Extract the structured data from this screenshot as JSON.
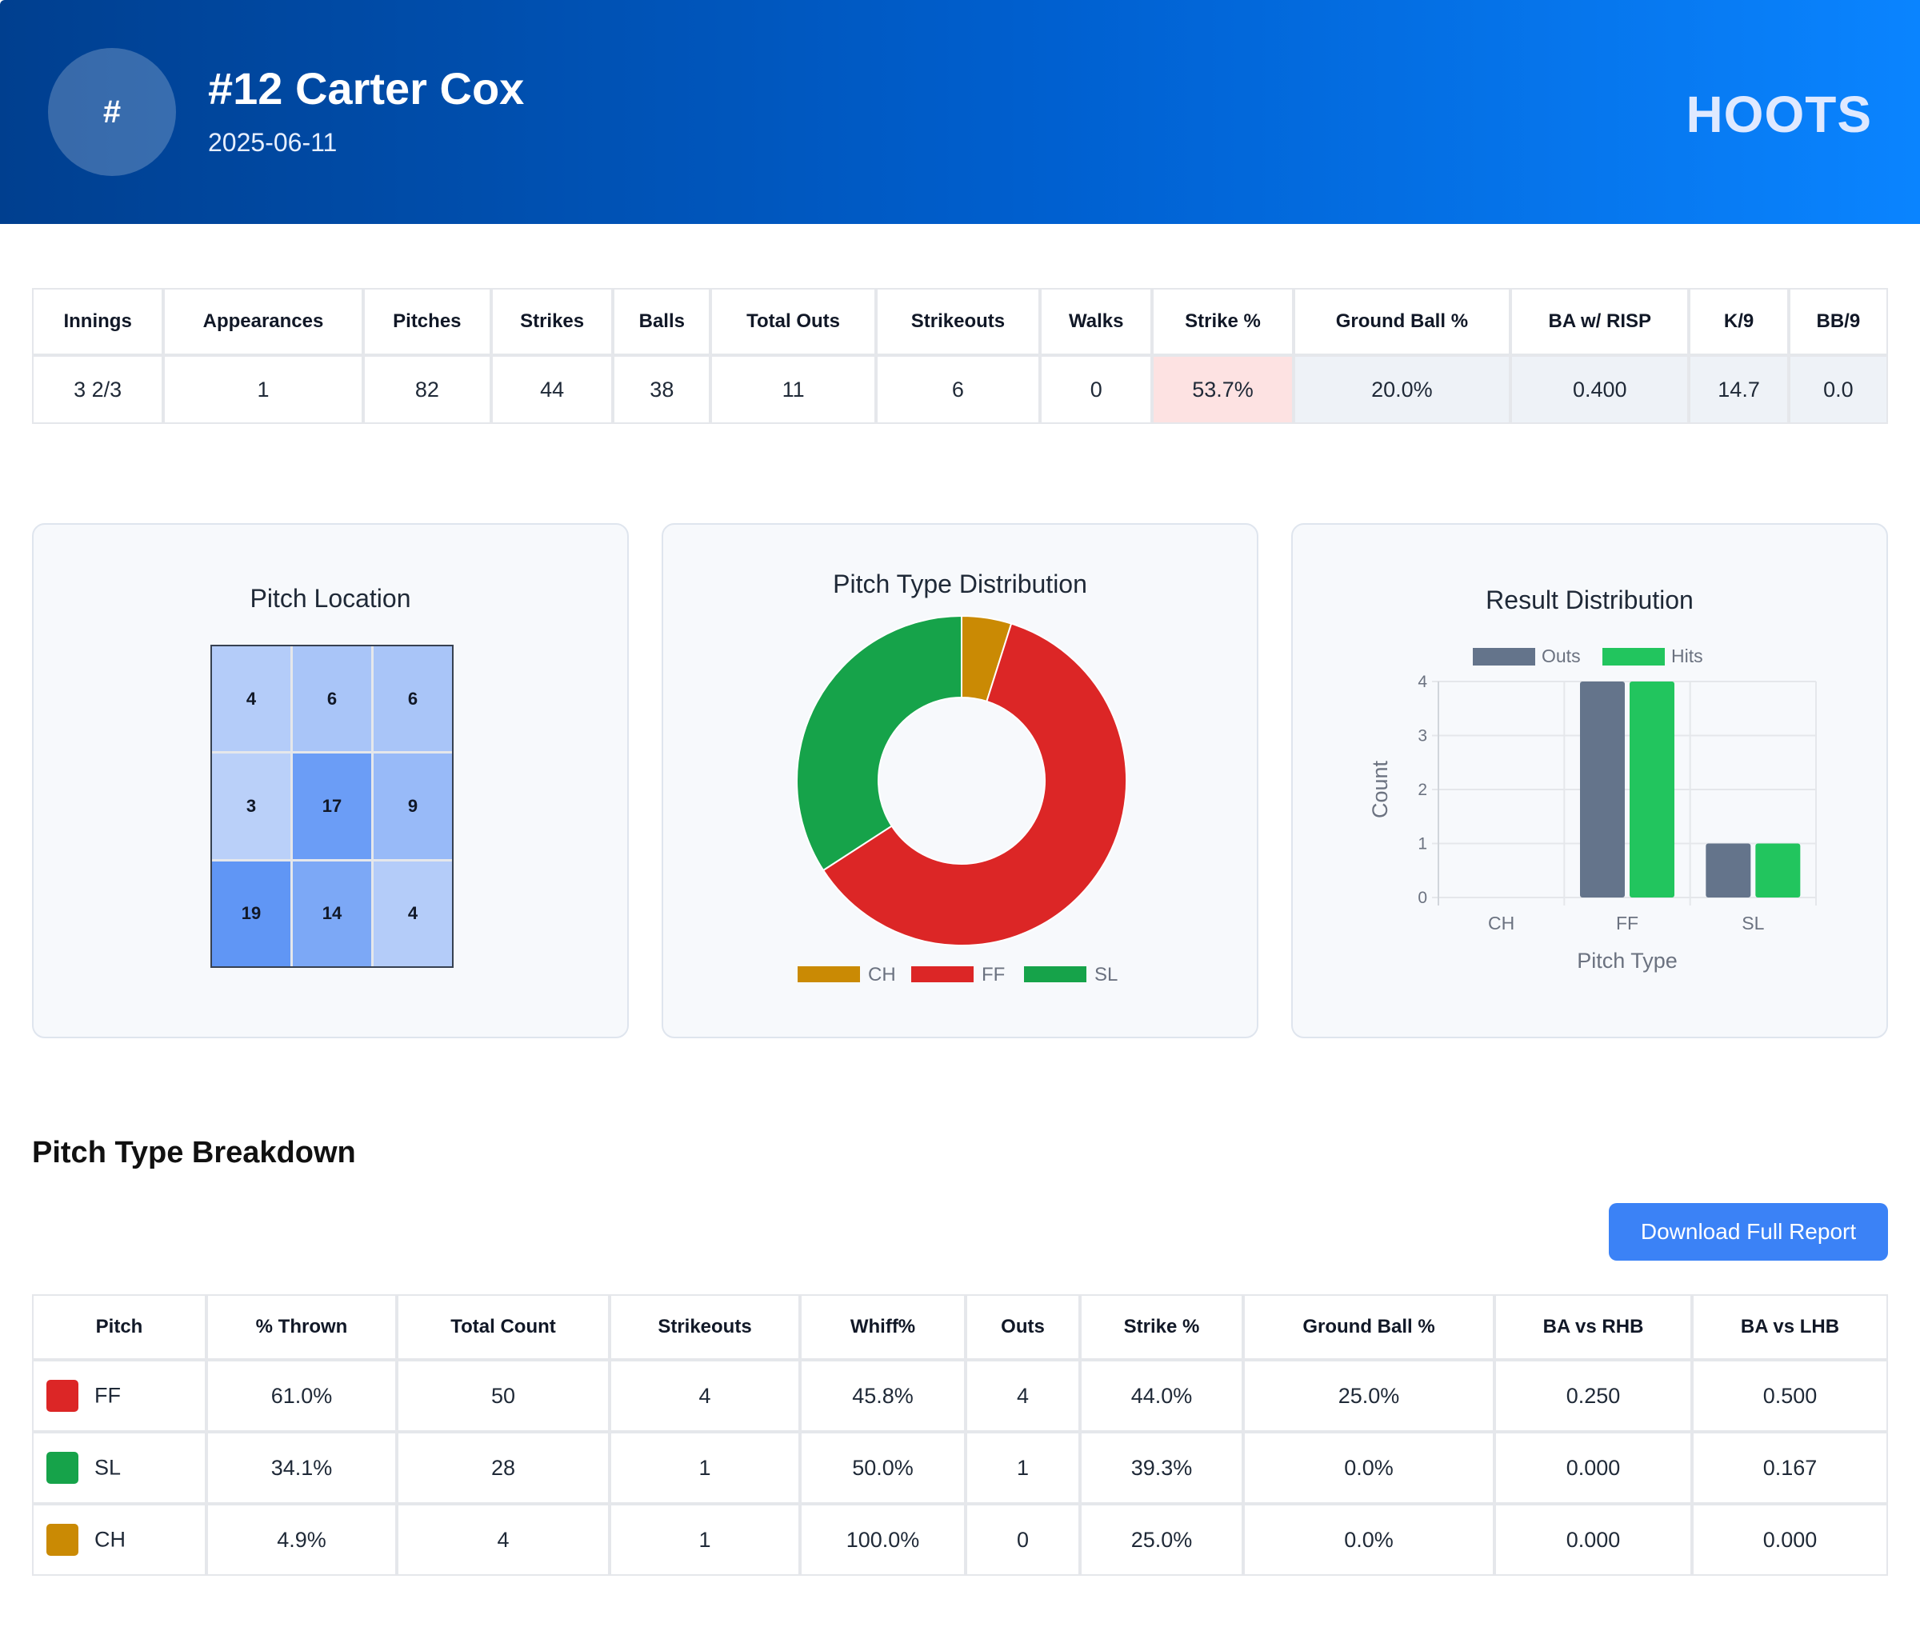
{
  "header": {
    "avatar_symbol": "#",
    "player": "#12 Carter Cox",
    "date": "2025-06-11",
    "team": "HOOTS"
  },
  "summary": {
    "columns": [
      "Innings",
      "Appearances",
      "Pitches",
      "Strikes",
      "Balls",
      "Total Outs",
      "Strikeouts",
      "Walks",
      "Strike %",
      "Ground Ball %",
      "BA w/ RISP",
      "K/9",
      "BB/9"
    ],
    "values": [
      "3 2/3",
      "1",
      "82",
      "44",
      "38",
      "11",
      "6",
      "0",
      "53.7%",
      "20.0%",
      "0.400",
      "14.7",
      "0.0"
    ]
  },
  "pitch_location": {
    "title": "Pitch Location",
    "zones": [
      "4",
      "6",
      "6",
      "3",
      "17",
      "9",
      "19",
      "14",
      "4"
    ]
  },
  "colors": {
    "FF": "#dc2626",
    "SL": "#16a34a",
    "CH": "#ca8a04",
    "outs": "#64748b",
    "hits": "#22c55e",
    "header_start": "#003f8f",
    "header_end": "#0a84ff",
    "button": "#3b82f6"
  },
  "chart_data": [
    {
      "type": "pie",
      "title": "Pitch Type Distribution",
      "categories": [
        "CH",
        "FF",
        "SL"
      ],
      "values": [
        4,
        50,
        28
      ],
      "colors": [
        "#ca8a04",
        "#dc2626",
        "#16a34a"
      ],
      "donut": true,
      "legend": "bottom"
    },
    {
      "type": "bar",
      "title": "Result Distribution",
      "categories": [
        "CH",
        "FF",
        "SL"
      ],
      "series": [
        {
          "name": "Outs",
          "values": [
            0,
            4,
            1
          ],
          "color": "#64748b"
        },
        {
          "name": "Hits",
          "values": [
            0,
            4,
            1
          ],
          "color": "#22c55e"
        }
      ],
      "xlabel": "Pitch Type",
      "ylabel": "Count",
      "ylim": [
        0,
        4
      ],
      "yticks": [
        "0",
        "1",
        "2",
        "3",
        "4"
      ],
      "legend": "top",
      "grid": true
    }
  ],
  "breakdown": {
    "title": "Pitch Type Breakdown",
    "download_label": "Download Full Report",
    "columns": [
      "Pitch",
      "% Thrown",
      "Total Count",
      "Strikeouts",
      "Whiff%",
      "Outs",
      "Strike %",
      "Ground Ball %",
      "BA vs RHB",
      "BA vs LHB"
    ],
    "rows": [
      {
        "pitch": "FF",
        "thrown": "61.0%",
        "count": "50",
        "so": "4",
        "whiff": "45.8%",
        "outs": "4",
        "strike": "44.0%",
        "gb": "25.0%",
        "rhb": "0.250",
        "lhb": "0.500"
      },
      {
        "pitch": "SL",
        "thrown": "34.1%",
        "count": "28",
        "so": "1",
        "whiff": "50.0%",
        "outs": "1",
        "strike": "39.3%",
        "gb": "0.0%",
        "rhb": "0.000",
        "lhb": "0.167"
      },
      {
        "pitch": "CH",
        "thrown": "4.9%",
        "count": "4",
        "so": "1",
        "whiff": "100.0%",
        "outs": "0",
        "strike": "25.0%",
        "gb": "0.0%",
        "rhb": "0.000",
        "lhb": "0.000"
      }
    ]
  }
}
